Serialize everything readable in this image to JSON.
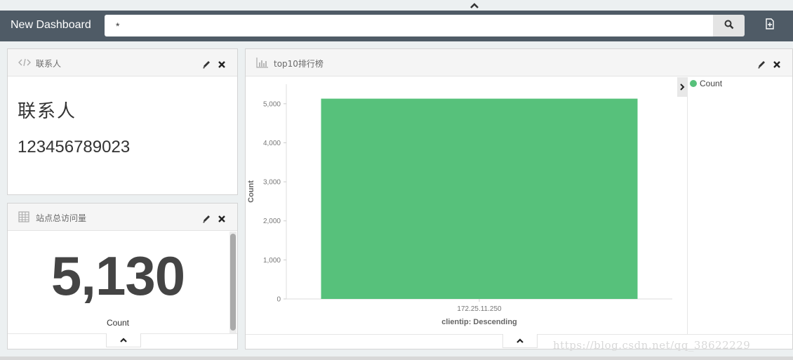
{
  "app": {
    "title": "New Dashboard",
    "search_value": "*"
  },
  "icons": {
    "collapse": "chevron-up-icon",
    "search": "search-icon",
    "new": "new-document-icon",
    "edit": "pencil-icon",
    "close": "close-icon",
    "markdown": "code-icon",
    "metric": "table-grid-icon",
    "chart": "bar-chart-icon",
    "legend_toggle": "chevron-right-icon"
  },
  "panels": {
    "markdown": {
      "title": "联系人",
      "heading": "联系人",
      "text": "123456789023"
    },
    "metric": {
      "title": "站点总访问量",
      "value": "5,130",
      "label": "Count"
    },
    "chart": {
      "title": "top10排行榜",
      "legend": [
        {
          "label": "Count",
          "color": "#57c17b"
        }
      ]
    }
  },
  "chart_data": {
    "type": "bar",
    "categories": [
      "172.25.11.250"
    ],
    "series": [
      {
        "name": "Count",
        "values": [
          5130
        ],
        "color": "#57c17b"
      }
    ],
    "y_ticks": [
      "0",
      "1,000",
      "2,000",
      "3,000",
      "4,000",
      "5,000"
    ],
    "ylim": [
      0,
      5500
    ],
    "xlabel": "clientip: Descending",
    "ylabel": "Count",
    "legend_position": "right"
  },
  "watermark": "https://blog.csdn.net/qq_38622229"
}
